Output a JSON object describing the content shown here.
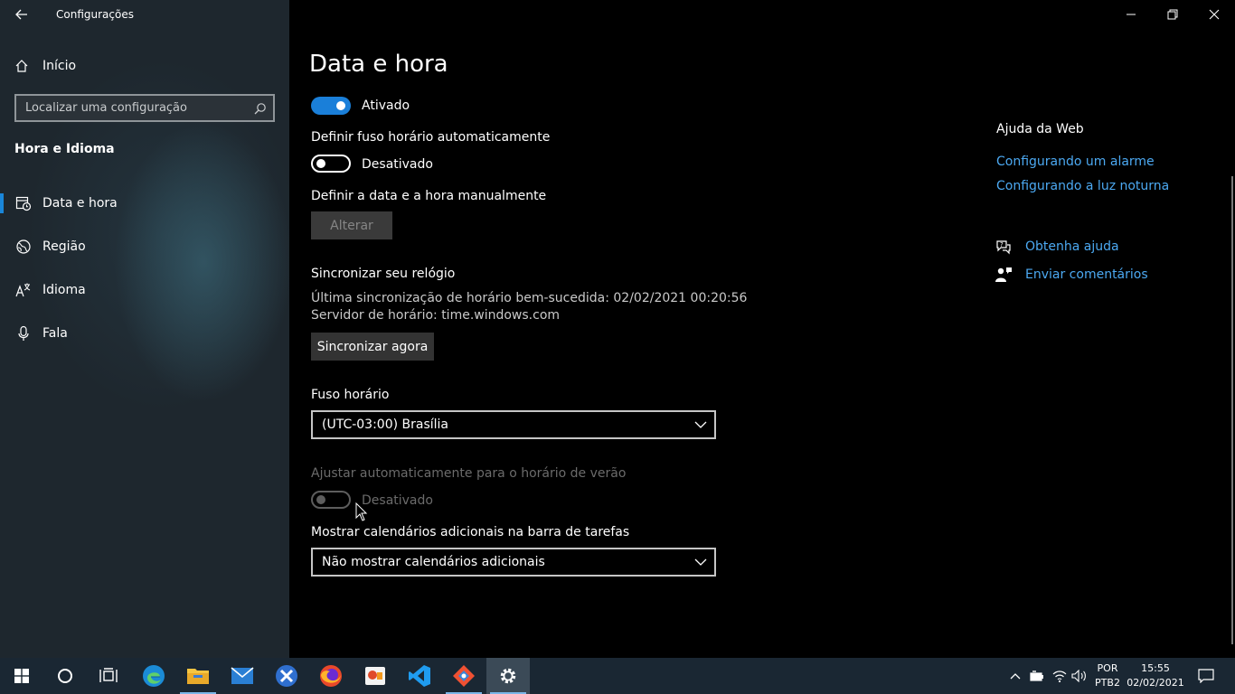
{
  "window": {
    "app_title": "Configurações"
  },
  "sidebar": {
    "home_label": "Início",
    "search_placeholder": "Localizar uma configuração",
    "section_title": "Hora e Idioma",
    "items": [
      {
        "label": "Data e hora",
        "icon": "calendar-clock-icon",
        "active": true
      },
      {
        "label": "Região",
        "icon": "globe-icon",
        "active": false
      },
      {
        "label": "Idioma",
        "icon": "language-icon",
        "active": false
      },
      {
        "label": "Fala",
        "icon": "microphone-icon",
        "active": false
      }
    ]
  },
  "main": {
    "page_title": "Data e hora",
    "auto_time_toggle": {
      "state": "Ativado",
      "on": true
    },
    "auto_timezone": {
      "label": "Definir fuso horário automaticamente",
      "state": "Desativado",
      "on": false
    },
    "manual": {
      "label": "Definir a data e a hora manualmente",
      "button": "Alterar"
    },
    "sync": {
      "label": "Sincronizar seu relógio",
      "last_sync": "Última sincronização de horário bem-sucedida: 02/02/2021 00:20:56",
      "server": "Servidor de horário: time.windows.com",
      "button": "Sincronizar agora"
    },
    "timezone": {
      "label": "Fuso horário",
      "value": "(UTC-03:00) Brasília"
    },
    "dst": {
      "label": "Ajustar automaticamente para o horário de verão",
      "state": "Desativado",
      "on": false,
      "disabled": true
    },
    "calendars": {
      "label": "Mostrar calendários adicionais na barra de tarefas",
      "value": "Não mostrar calendários adicionais"
    }
  },
  "help": {
    "title": "Ajuda da Web",
    "links": [
      "Configurando um alarme",
      "Configurando a luz noturna"
    ],
    "get_help": "Obtenha ajuda",
    "feedback": "Enviar comentários"
  },
  "taskbar": {
    "lang_line1": "POR",
    "lang_line2": "PTB2",
    "time": "15:55",
    "date": "02/02/2021"
  },
  "colors": {
    "accent": "#1a7fd9",
    "link": "#4ca9f2",
    "sidebar_bg": "#1e272e",
    "taskbar_bg": "#1a2733"
  }
}
